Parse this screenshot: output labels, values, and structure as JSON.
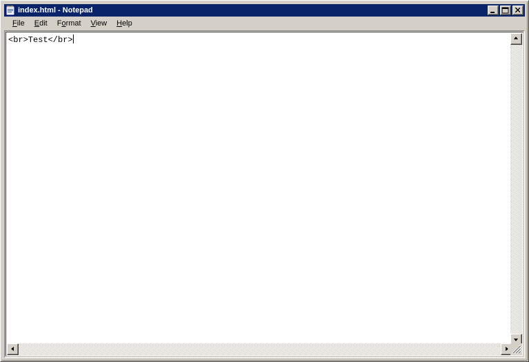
{
  "window": {
    "title": "index.html - Notepad",
    "icon": "notepad-icon",
    "active_title_color": "#0a246a",
    "face_color": "#d4d0c8"
  },
  "titlebar_buttons": [
    {
      "name": "minimize",
      "label": "Minimize",
      "glyph": "minimize-glyph"
    },
    {
      "name": "maximize",
      "label": "Maximize",
      "glyph": "maximize-glyph"
    },
    {
      "name": "close",
      "label": "Close",
      "glyph": "close-glyph"
    }
  ],
  "menubar": {
    "items": [
      {
        "label": "File",
        "accel": "F",
        "before": "",
        "after": "ile"
      },
      {
        "label": "Edit",
        "accel": "E",
        "before": "",
        "after": "dit"
      },
      {
        "label": "Format",
        "accel": "o",
        "before": "F",
        "after": "rmat"
      },
      {
        "label": "View",
        "accel": "V",
        "before": "",
        "after": "iew"
      },
      {
        "label": "Help",
        "accel": "H",
        "before": "",
        "after": "elp"
      }
    ]
  },
  "document": {
    "content": "<br>Test</br>",
    "caret_after_text": true,
    "wordwrap": false
  },
  "scrollbars": {
    "vertical": {
      "up_label": "Scroll up",
      "down_label": "Scroll down",
      "thumb_visible": false
    },
    "horizontal": {
      "left_label": "Scroll left",
      "right_label": "Scroll right",
      "thumb_visible": false
    },
    "sizegrip_label": "Resize window"
  }
}
